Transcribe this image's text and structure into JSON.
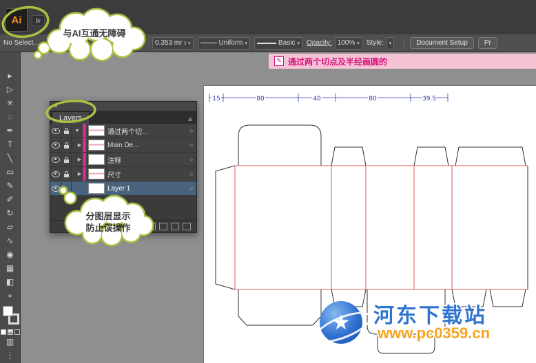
{
  "app": {
    "logo_label": "Ai",
    "bridge_label": "Br"
  },
  "control_bar": {
    "selection_status": "No Select...",
    "stroke_weight": "0.353 mr",
    "width_profile": "Uniform",
    "brush_definition": "Basic",
    "opacity_label": "Opacity:",
    "opacity_value": "100%",
    "style_label": "Style:",
    "document_setup": "Document Setup",
    "preferences": "Pr"
  },
  "notice_bar": {
    "text": "通过两个切点及半经画圆的"
  },
  "callouts": {
    "ai_cloud_text": "与AI互通无障碍",
    "layers_cloud_line1": "分图层显示",
    "layers_cloud_line2": "防止误操作"
  },
  "toolbar": {
    "tools": [
      {
        "name": "selection-tool",
        "glyph": "▸"
      },
      {
        "name": "direct-selection-tool",
        "glyph": "▷"
      },
      {
        "name": "magic-wand-tool",
        "glyph": "✳"
      },
      {
        "name": "lasso-tool",
        "glyph": "◌"
      },
      {
        "name": "pen-tool",
        "glyph": "✒"
      },
      {
        "name": "type-tool",
        "glyph": "T"
      },
      {
        "name": "line-segment-tool",
        "glyph": "╲"
      },
      {
        "name": "rectangle-tool",
        "glyph": "▭"
      },
      {
        "name": "paintbrush-tool",
        "glyph": "✎"
      },
      {
        "name": "pencil-tool",
        "glyph": "✐"
      },
      {
        "name": "rotate-tool",
        "glyph": "↻"
      },
      {
        "name": "scale-tool",
        "glyph": "▱"
      },
      {
        "name": "width-tool",
        "glyph": "∿"
      },
      {
        "name": "blend-tool",
        "glyph": "◉"
      },
      {
        "name": "perspective-grid-tool",
        "glyph": "▦"
      },
      {
        "name": "gradient-tool",
        "glyph": "◧"
      },
      {
        "name": "eyedropper-tool",
        "glyph": "⌖"
      }
    ]
  },
  "layers_panel": {
    "close_glyph": "✕",
    "tab_label": "Layers",
    "menu_glyph": "≡",
    "target_glyph": "○",
    "rows": [
      {
        "name": "通过两个切…",
        "arrow": "▼"
      },
      {
        "name": "Main De…",
        "arrow": "▶"
      },
      {
        "name": "注释",
        "arrow": "▶"
      },
      {
        "name": "尺寸",
        "arrow": "▶"
      },
      {
        "name": "Layer 1",
        "arrow": ""
      }
    ]
  },
  "dieline": {
    "dimension_labels": [
      "15",
      "80",
      "40",
      "80",
      "39.5"
    ]
  },
  "watermark": {
    "site_name": "河东下载站",
    "site_url": "www.pc0359.cn",
    "star_glyph": "★"
  },
  "colors": {
    "accent_green": "#a9c23f",
    "fold_red": "#e05a5a",
    "dimension_blue": "#2b35b5",
    "notice_pink": "#f5c3d6",
    "notice_text": "#d6147e",
    "logo_orange": "#f7941d",
    "watermark_blue": "#2f74d0",
    "watermark_orange": "#f6a41d"
  }
}
